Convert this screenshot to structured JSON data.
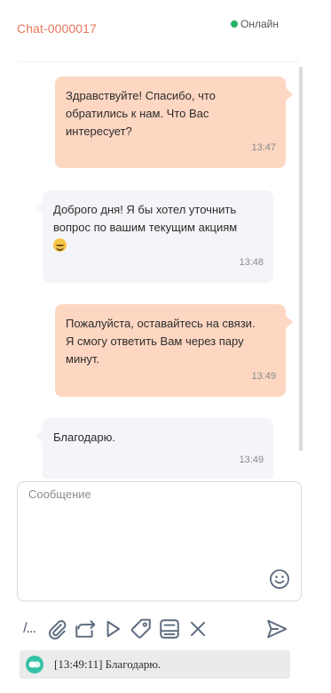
{
  "header": {
    "chat_title": "Chat-0000017",
    "status_label": "Онлайн",
    "status_color": "#27b36a"
  },
  "messages": [
    {
      "direction": "outgoing",
      "text": "Здравствуйте! Спасибо, что\nобратились к нам. Что Вас\nинтересует?",
      "time": "13:47"
    },
    {
      "direction": "incoming",
      "text": "Доброго дня! Я бы хотел уточнить\nвопрос по вашим текущим акциям",
      "emoji": "smiling-face-icon",
      "time": "13:48"
    },
    {
      "direction": "outgoing",
      "text": "Пожалуйста, оставайтесь на связи.\nЯ смогу ответить Вам через пару\nминут.",
      "time": "13:49"
    },
    {
      "direction": "incoming",
      "text": "Благодарю.",
      "time": "13:49"
    }
  ],
  "composer": {
    "placeholder": "Сообщение",
    "value": ""
  },
  "toolbar": {
    "commands_label": "/...",
    "icons": [
      "paperclip-icon",
      "forward-icon",
      "play-icon",
      "tag-icon",
      "archive-icon",
      "close-icon",
      "send-icon"
    ]
  },
  "notification": {
    "text": "[13:49:11] Благодарю."
  },
  "colors": {
    "accent": "#e8765b",
    "outgoing_bubble": "#fdd7c2",
    "incoming_bubble": "#f4f5f8",
    "notification_icon": "#33c2a6"
  }
}
